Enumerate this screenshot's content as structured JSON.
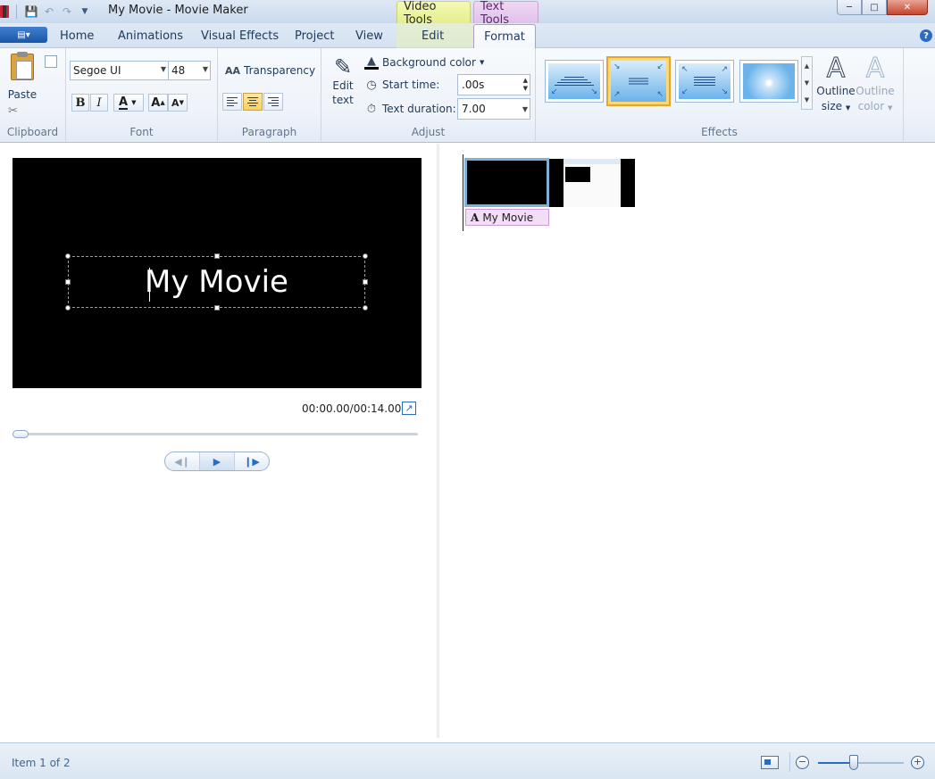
{
  "window": {
    "title": "My Movie - Movie Maker",
    "context_tabs": {
      "video_tools": "Video Tools",
      "text_tools": "Text Tools"
    }
  },
  "tabs": {
    "home": "Home",
    "animations": "Animations",
    "visual_effects": "Visual Effects",
    "project": "Project",
    "view": "View",
    "edit": "Edit",
    "format": "Format"
  },
  "ribbon": {
    "clipboard": {
      "paste": "Paste",
      "group": "Clipboard"
    },
    "font": {
      "family": "Segoe UI",
      "size": "48",
      "bold": "B",
      "italic": "I",
      "color": "A",
      "grow": "A",
      "shrink": "A",
      "group": "Font"
    },
    "paragraph": {
      "transparency": "Transparency",
      "transparency_icon": "AA",
      "group": "Paragraph"
    },
    "adjust": {
      "edit_text_line1": "Edit",
      "edit_text_line2": "text",
      "background_color": "Background color",
      "start_time_label": "Start time:",
      "start_time_value": ".00s",
      "text_duration_label": "Text duration:",
      "text_duration_value": "7.00",
      "group": "Adjust"
    },
    "effects": {
      "group": "Effects",
      "outline_size_line1": "Outline",
      "outline_size_line2": "size",
      "outline_color_line1": "Outline",
      "outline_color_line2": "color",
      "outline_letter": "A"
    }
  },
  "preview": {
    "caption": "My Movie",
    "time": "00:00.00/00:14.00",
    "playhead_fraction": 0
  },
  "storyboard": {
    "caption_chip": "My Movie",
    "caption_icon": "A"
  },
  "status": {
    "item_text": "Item 1 of 2"
  },
  "colors": {
    "accent": "#2a6cc4",
    "selected_effect": "#ffd773",
    "text_tools_context": "#e0c0ea",
    "video_tools_context": "#e4ee8c"
  }
}
